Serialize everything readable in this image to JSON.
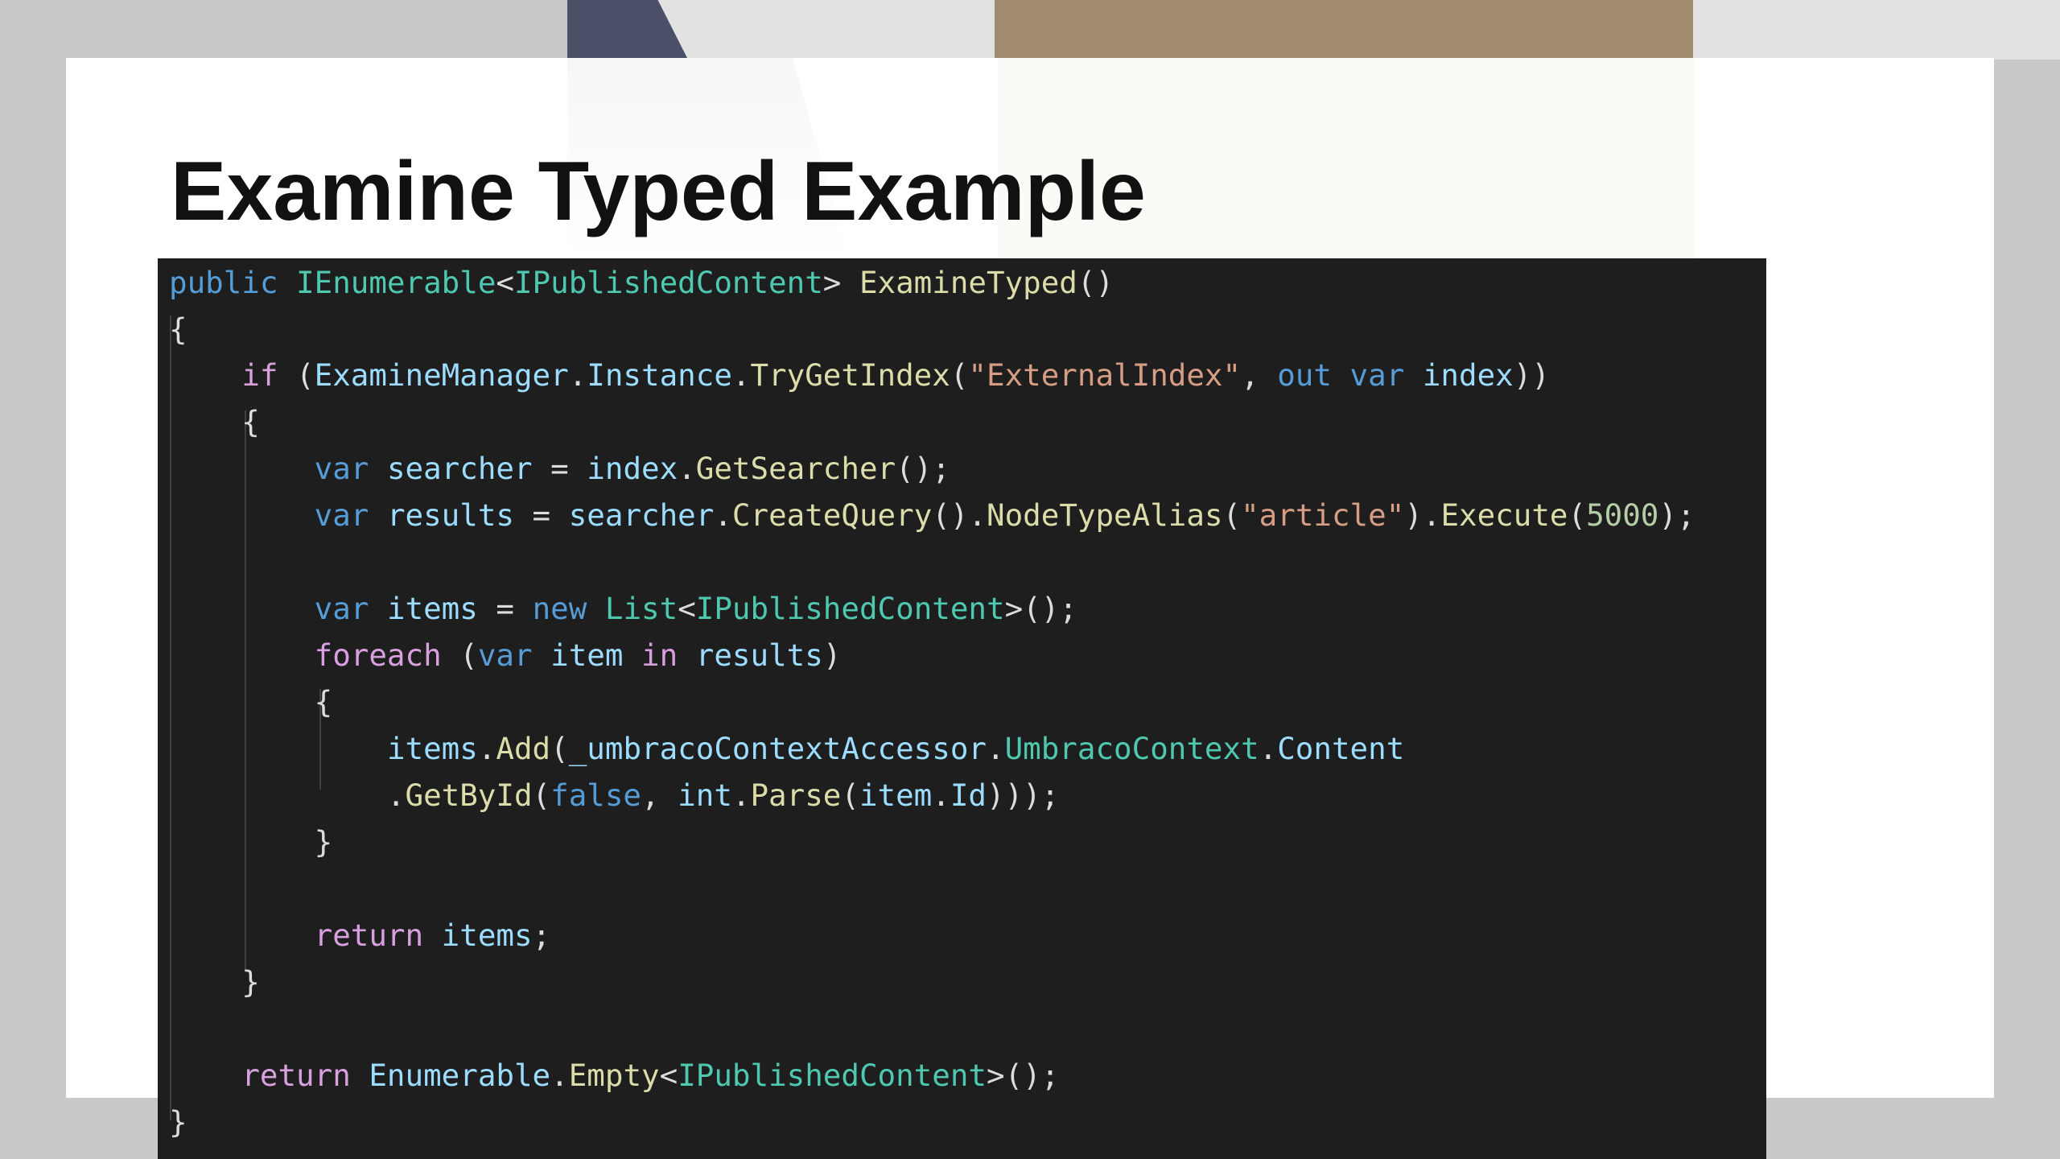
{
  "slide": {
    "title": "Examine Typed Example"
  },
  "code": {
    "language": "csharp",
    "lines": [
      [
        {
          "t": "public",
          "c": "kw"
        },
        {
          "t": " ",
          "c": "pun"
        },
        {
          "t": "IEnumerable",
          "c": "type"
        },
        {
          "t": "<",
          "c": "pun"
        },
        {
          "t": "IPublishedContent",
          "c": "type"
        },
        {
          "t": "> ",
          "c": "pun"
        },
        {
          "t": "ExamineTyped",
          "c": "meth"
        },
        {
          "t": "()",
          "c": "pun"
        }
      ],
      [
        {
          "t": "{",
          "c": "pun"
        }
      ],
      [
        {
          "t": "    ",
          "c": "pun"
        },
        {
          "t": "if",
          "c": "ctrl"
        },
        {
          "t": " (",
          "c": "pun"
        },
        {
          "t": "ExamineManager",
          "c": "vari"
        },
        {
          "t": ".",
          "c": "pun"
        },
        {
          "t": "Instance",
          "c": "vari"
        },
        {
          "t": ".",
          "c": "pun"
        },
        {
          "t": "TryGetIndex",
          "c": "meth"
        },
        {
          "t": "(",
          "c": "pun"
        },
        {
          "t": "\"ExternalIndex\"",
          "c": "str"
        },
        {
          "t": ", ",
          "c": "pun"
        },
        {
          "t": "out",
          "c": "kw"
        },
        {
          "t": " ",
          "c": "pun"
        },
        {
          "t": "var",
          "c": "kw"
        },
        {
          "t": " ",
          "c": "pun"
        },
        {
          "t": "index",
          "c": "vari"
        },
        {
          "t": "))",
          "c": "pun"
        }
      ],
      [
        {
          "t": "    {",
          "c": "pun"
        }
      ],
      [
        {
          "t": "        ",
          "c": "pun"
        },
        {
          "t": "var",
          "c": "kw"
        },
        {
          "t": " ",
          "c": "pun"
        },
        {
          "t": "searcher",
          "c": "vari"
        },
        {
          "t": " = ",
          "c": "pun"
        },
        {
          "t": "index",
          "c": "vari"
        },
        {
          "t": ".",
          "c": "pun"
        },
        {
          "t": "GetSearcher",
          "c": "meth"
        },
        {
          "t": "();",
          "c": "pun"
        }
      ],
      [
        {
          "t": "        ",
          "c": "pun"
        },
        {
          "t": "var",
          "c": "kw"
        },
        {
          "t": " ",
          "c": "pun"
        },
        {
          "t": "results",
          "c": "vari"
        },
        {
          "t": " = ",
          "c": "pun"
        },
        {
          "t": "searcher",
          "c": "vari"
        },
        {
          "t": ".",
          "c": "pun"
        },
        {
          "t": "CreateQuery",
          "c": "meth"
        },
        {
          "t": "().",
          "c": "pun"
        },
        {
          "t": "NodeTypeAlias",
          "c": "meth"
        },
        {
          "t": "(",
          "c": "pun"
        },
        {
          "t": "\"article\"",
          "c": "str"
        },
        {
          "t": ").",
          "c": "pun"
        },
        {
          "t": "Execute",
          "c": "meth"
        },
        {
          "t": "(",
          "c": "pun"
        },
        {
          "t": "5000",
          "c": "num"
        },
        {
          "t": ");",
          "c": "pun"
        }
      ],
      [],
      [
        {
          "t": "        ",
          "c": "pun"
        },
        {
          "t": "var",
          "c": "kw"
        },
        {
          "t": " ",
          "c": "pun"
        },
        {
          "t": "items",
          "c": "vari"
        },
        {
          "t": " = ",
          "c": "pun"
        },
        {
          "t": "new",
          "c": "kw"
        },
        {
          "t": " ",
          "c": "pun"
        },
        {
          "t": "List",
          "c": "type"
        },
        {
          "t": "<",
          "c": "pun"
        },
        {
          "t": "IPublishedContent",
          "c": "type"
        },
        {
          "t": ">();",
          "c": "pun"
        }
      ],
      [
        {
          "t": "        ",
          "c": "pun"
        },
        {
          "t": "foreach",
          "c": "ctrl"
        },
        {
          "t": " (",
          "c": "pun"
        },
        {
          "t": "var",
          "c": "kw"
        },
        {
          "t": " ",
          "c": "pun"
        },
        {
          "t": "item",
          "c": "vari"
        },
        {
          "t": " ",
          "c": "pun"
        },
        {
          "t": "in",
          "c": "ctrl"
        },
        {
          "t": " ",
          "c": "pun"
        },
        {
          "t": "results",
          "c": "vari"
        },
        {
          "t": ")",
          "c": "pun"
        }
      ],
      [
        {
          "t": "        {",
          "c": "pun"
        }
      ],
      [
        {
          "t": "            ",
          "c": "pun"
        },
        {
          "t": "items",
          "c": "vari"
        },
        {
          "t": ".",
          "c": "pun"
        },
        {
          "t": "Add",
          "c": "meth"
        },
        {
          "t": "(",
          "c": "pun"
        },
        {
          "t": "_umbracoContextAccessor",
          "c": "vari"
        },
        {
          "t": ".",
          "c": "pun"
        },
        {
          "t": "UmbracoContext",
          "c": "type"
        },
        {
          "t": ".",
          "c": "pun"
        },
        {
          "t": "Content",
          "c": "vari"
        }
      ],
      [
        {
          "t": "            .",
          "c": "pun"
        },
        {
          "t": "GetById",
          "c": "meth"
        },
        {
          "t": "(",
          "c": "pun"
        },
        {
          "t": "false",
          "c": "kw"
        },
        {
          "t": ", ",
          "c": "pun"
        },
        {
          "t": "int",
          "c": "vari"
        },
        {
          "t": ".",
          "c": "pun"
        },
        {
          "t": "Parse",
          "c": "meth"
        },
        {
          "t": "(",
          "c": "pun"
        },
        {
          "t": "item",
          "c": "vari"
        },
        {
          "t": ".",
          "c": "pun"
        },
        {
          "t": "Id",
          "c": "vari"
        },
        {
          "t": ")));",
          "c": "pun"
        }
      ],
      [
        {
          "t": "        }",
          "c": "pun"
        }
      ],
      [],
      [
        {
          "t": "        ",
          "c": "pun"
        },
        {
          "t": "return",
          "c": "ctrl"
        },
        {
          "t": " ",
          "c": "pun"
        },
        {
          "t": "items",
          "c": "vari"
        },
        {
          "t": ";",
          "c": "pun"
        }
      ],
      [
        {
          "t": "    }",
          "c": "pun"
        }
      ],
      [],
      [
        {
          "t": "    ",
          "c": "pun"
        },
        {
          "t": "return",
          "c": "ctrl"
        },
        {
          "t": " ",
          "c": "pun"
        },
        {
          "t": "Enumerable",
          "c": "vari"
        },
        {
          "t": ".",
          "c": "pun"
        },
        {
          "t": "Empty",
          "c": "meth"
        },
        {
          "t": "<",
          "c": "pun"
        },
        {
          "t": "IPublishedContent",
          "c": "type"
        },
        {
          "t": ">();",
          "c": "pun"
        }
      ],
      [
        {
          "t": "}",
          "c": "pun"
        }
      ]
    ]
  }
}
